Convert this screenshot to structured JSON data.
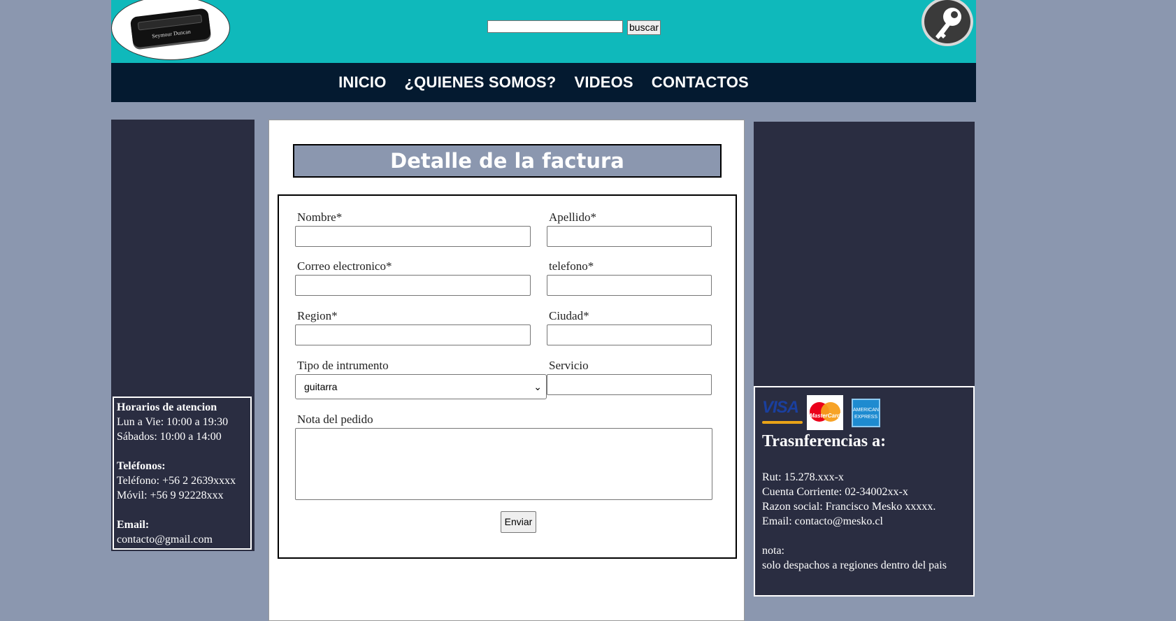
{
  "header": {
    "logo_text": "Seymour Duncan",
    "search": {
      "value": "",
      "button_label": "buscar"
    }
  },
  "nav": {
    "items": [
      "INICIO",
      "¿QUIENES SOMOS?",
      "VIDEOS",
      "CONTACTOS"
    ]
  },
  "left_info": {
    "hours_title": "Horarios de atencion",
    "hours_weekday": "Lun a Vie: 10:00 a 19:30",
    "hours_saturday": "Sábados: 10:00 a 14:00",
    "phones_title": "Teléfonos:",
    "phone": "Teléfono: +56 2 2639xxxx",
    "mobile": "Móvil: +56 9 92228xxx",
    "email_title": "Email:",
    "email": "contacto@gmail.com"
  },
  "form": {
    "title": "Detalle de la factura",
    "nombre_label": "Nombre*",
    "apellido_label": "Apellido*",
    "correo_label": "Correo electronico*",
    "telefono_label": "telefono*",
    "region_label": "Region*",
    "ciudad_label": "Ciudad*",
    "instrumento_label": "Tipo de intrumento",
    "instrumento_value": "guitarra",
    "servicio_label": "Servicio",
    "nota_label": "Nota del pedido",
    "submit_label": "Enviar"
  },
  "right_info": {
    "cards": {
      "visa": "VISA",
      "mastercard": "MasterCard",
      "amex": "AMERICAN EXPRESS"
    },
    "title": "Trasnferencias a:",
    "rut": "Rut: 15.278.xxx-x",
    "cuenta": "Cuenta Corriente: 02-34002xx-x",
    "razon": "Razon social: Francisco Mesko xxxxx.",
    "email": "Email: contacto@mesko.cl",
    "nota_title": "nota:",
    "nota_text": "solo despachos a regiones dentro del pais"
  },
  "colors": {
    "page_bg": "#8b97af",
    "header_bg": "#0fb9bb",
    "nav_bg": "#041a30",
    "panel_bg": "#2a2d41"
  }
}
